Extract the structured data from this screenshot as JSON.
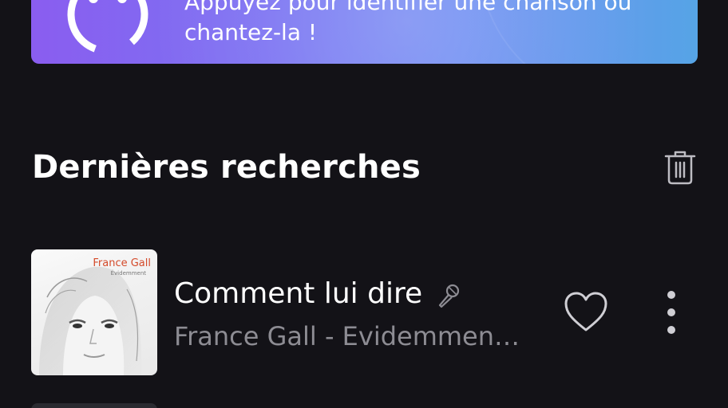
{
  "banner": {
    "text": "Appuyez pour identifier une chanson ou chantez-la !",
    "icon": "soundhound-logo-icon"
  },
  "recent_searches": {
    "title": "Dernières recherches",
    "clear_icon": "trash-icon",
    "items": [
      {
        "title": "Comment lui dire",
        "subtitle": "France Gall - Evidemment…",
        "cover_artist": "France Gall",
        "cover_album": "Évidemment",
        "has_lyrics_icon": "microphone-icon",
        "favorite_icon": "heart-icon",
        "more_icon": "more-vertical-icon"
      }
    ]
  },
  "colors": {
    "background": "#131217",
    "banner_gradient_start": "#8a5df0",
    "banner_gradient_end": "#56a4e6",
    "subtitle": "#8d8c93"
  }
}
